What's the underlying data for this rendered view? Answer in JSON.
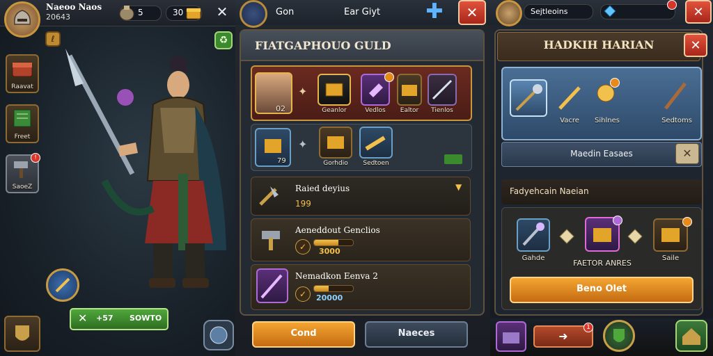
{
  "left": {
    "player_name": "Naeoo Naos",
    "player_id": "20643",
    "resource_count": "5",
    "gold_count": "30",
    "side_buttons": [
      {
        "label": "Raavat",
        "icon": "treasure-chest-icon",
        "badge": ""
      },
      {
        "label": "Freet",
        "icon": "scroll-icon",
        "badge": ""
      },
      {
        "label": "SaoeZ",
        "icon": "hammer-icon",
        "badge": "!"
      }
    ],
    "action_button": {
      "label": "SOWTO",
      "count": "+57"
    }
  },
  "mid": {
    "header_title": "Gon",
    "header_subtitle": "Ear Giyt",
    "guild_title": "FIATGAPHOUO GULD",
    "row1_items": [
      {
        "label": "",
        "count": "02"
      },
      {
        "label": "Geanlor",
        "count": ""
      },
      {
        "label": "Vedlos",
        "count": ""
      },
      {
        "label": "Ealtor",
        "count": ""
      },
      {
        "label": "Tienlos",
        "count": ""
      }
    ],
    "row2_items": [
      {
        "label": "",
        "count": "79"
      },
      {
        "label": "Gorhdio",
        "count": ""
      },
      {
        "label": "Sedtoen",
        "count": ""
      }
    ],
    "list": [
      {
        "title": "Raied deyius",
        "value": "199",
        "progress": null
      },
      {
        "title": "Aeneddout Genclios",
        "value": "3000",
        "progress": 0.62
      },
      {
        "title": "Nemadkon Eenva 2",
        "value": "20000",
        "progress": 0.38
      }
    ],
    "btn_primary": "Cond",
    "btn_secondary": "Naeces"
  },
  "right": {
    "top_name": "Sejtleoins",
    "title": "HADKIH HARIAN",
    "items": [
      {
        "label": ""
      },
      {
        "label": "Vacre"
      },
      {
        "label": "Sihlnes"
      },
      {
        "label": "Sedtoms"
      }
    ],
    "bar_label": "Maedin Easaes",
    "section_title": "Fadyehcain Naeian",
    "craft_left_label": "Gahde",
    "craft_center_label": "FAETOR ANRES",
    "craft_right_label": "Saile",
    "craft_button": "Beno Olet",
    "bottom_badge": "1"
  },
  "colors": {
    "gold": "#f2c04c",
    "accent_orange": "#e68a1c",
    "danger": "#d8362a",
    "green": "#4fa83b"
  }
}
